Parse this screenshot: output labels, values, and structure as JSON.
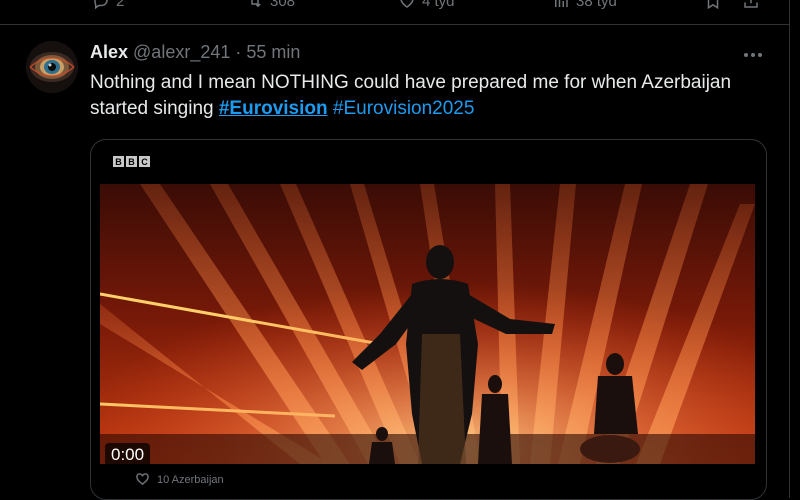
{
  "previous_tweet": {
    "reply_count": "2",
    "retweet_count": "308",
    "like_count": "4 tyd",
    "views_count": "38 tyd"
  },
  "tweet": {
    "author_name": "Alex",
    "handle": "@alexr_241",
    "separator": "·",
    "time": "55 min",
    "text_main": "Nothing and I mean NOTHING could have prepared me for when Azerbaijan started singing ",
    "hashtag_1": "#Eurovision",
    "hashtag_2": "#Eurovision2025",
    "media": {
      "broadcaster_letters": [
        "B",
        "B",
        "C"
      ],
      "duration": "0:00",
      "caption": "10 Azerbaijan"
    }
  },
  "colors": {
    "background": "#000000",
    "text": "#e7e9ea",
    "secondary": "#71767b",
    "link": "#1d9bf0",
    "border": "#2f3336"
  }
}
